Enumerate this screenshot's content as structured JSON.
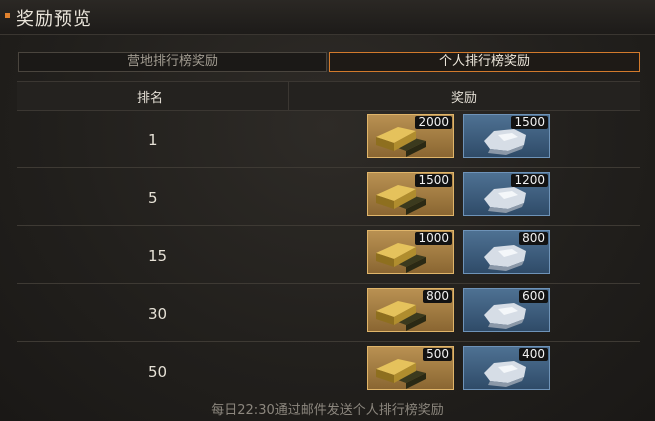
{
  "header": {
    "title": "奖励预览"
  },
  "tabs": [
    {
      "label": "营地排行榜奖励",
      "active": false
    },
    {
      "label": "个人排行榜奖励",
      "active": true
    }
  ],
  "table": {
    "columns": [
      "排名",
      "奖励"
    ],
    "rows": [
      {
        "rank": "1",
        "gold": "2000",
        "silver": "1500"
      },
      {
        "rank": "5",
        "gold": "1500",
        "silver": "1200"
      },
      {
        "rank": "15",
        "gold": "1000",
        "silver": "800"
      },
      {
        "rank": "30",
        "gold": "800",
        "silver": "600"
      },
      {
        "rank": "50",
        "gold": "500",
        "silver": "400"
      }
    ]
  },
  "footer": {
    "note": "每日22:30通过邮件发送个人排行榜奖励"
  },
  "icons": {
    "gold": "gold-bars-icon",
    "silver": "silver-ore-icon"
  },
  "colors": {
    "accent": "#d27a2c",
    "gold_bg": "#a37b42",
    "silver_bg": "#3f5f80"
  }
}
